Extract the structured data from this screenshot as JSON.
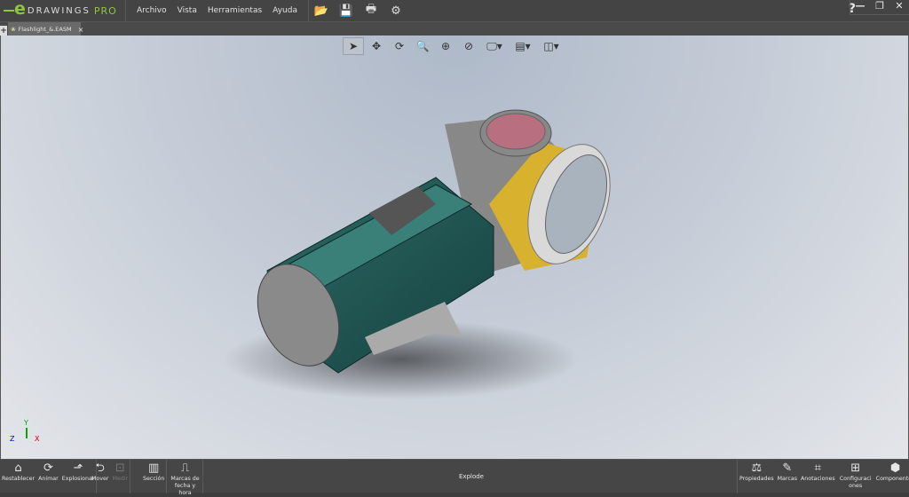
{
  "app": {
    "logo_text": "eDRAWINGS PRO",
    "logo_e": "e",
    "logo_drawings": "DRAWINGS",
    "logo_pro": "PRO"
  },
  "menu": [
    "Archivo",
    "Vista",
    "Herramientas",
    "Ayuda"
  ],
  "window": {
    "help": "?",
    "minimize": "—",
    "restore": "❐",
    "close": "✕"
  },
  "tabs": [
    {
      "label": "Flashlight_&.EASM",
      "close": "×"
    }
  ],
  "new_tab": "+",
  "bottom": {
    "left": [
      {
        "label": "Restablecer",
        "icon": "⌂"
      },
      {
        "label": "Animar",
        "icon": "⟳"
      },
      {
        "label": "Explosionar",
        "icon": "⬏"
      }
    ],
    "mid": [
      {
        "label": "Mover",
        "icon": "⮌"
      },
      {
        "label": "Medir",
        "icon": "⊡"
      }
    ],
    "sec": [
      {
        "label": "Sección",
        "icon": "▥"
      }
    ],
    "marks": [
      {
        "label": "Marcas de fecha y hora",
        "icon": "⎍"
      }
    ],
    "right": [
      {
        "label": "Propiedades",
        "icon": "⚖"
      },
      {
        "label": "Marcas",
        "icon": "✎"
      },
      {
        "label": "Anotaciones",
        "icon": "⌗"
      },
      {
        "label": "Configuraciones",
        "icon": "⊞"
      },
      {
        "label": "Componentes",
        "icon": "⬢"
      }
    ],
    "status": "Explode"
  },
  "triad": {
    "x": "X",
    "y": "Y",
    "z": "Z"
  }
}
